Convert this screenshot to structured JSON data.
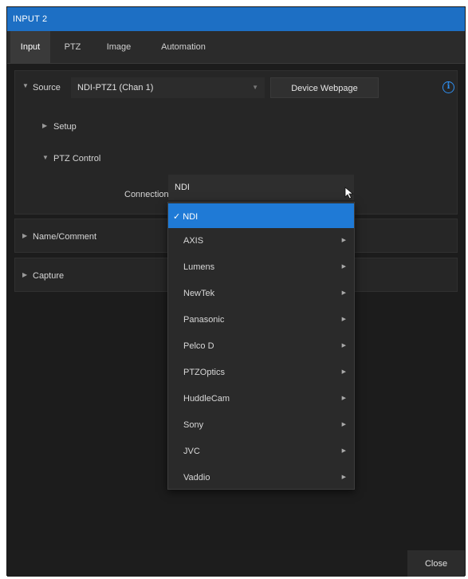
{
  "window": {
    "title": "INPUT 2"
  },
  "tabs": [
    {
      "label": "Input",
      "active": true
    },
    {
      "label": "PTZ",
      "active": false
    },
    {
      "label": "Image",
      "active": false
    },
    {
      "label": "Automation",
      "active": false
    }
  ],
  "source": {
    "label": "Source",
    "value": "NDI-PTZ1 (Chan 1)",
    "webpage_button": "Device Webpage",
    "setup_label": "Setup",
    "ptz_control_label": "PTZ Control"
  },
  "connection": {
    "label": "Connection",
    "value": "NDI",
    "options": [
      {
        "label": "NDI",
        "selected": true,
        "check": "✓"
      },
      {
        "label": "AXIS",
        "has_submenu": true
      },
      {
        "label": "Lumens",
        "has_submenu": true
      },
      {
        "label": "NewTek",
        "has_submenu": true
      },
      {
        "label": "Panasonic",
        "has_submenu": true
      },
      {
        "label": "Pelco D",
        "has_submenu": true
      },
      {
        "label": "PTZOptics",
        "has_submenu": true
      },
      {
        "label": "HuddleCam",
        "has_submenu": true
      },
      {
        "label": "Sony",
        "has_submenu": true
      },
      {
        "label": "JVC",
        "has_submenu": true
      },
      {
        "label": "Vaddio",
        "has_submenu": true
      }
    ]
  },
  "sections": {
    "name_comment": "Name/Comment",
    "capture": "Capture"
  },
  "footer": {
    "close_label": "Close"
  },
  "colors": {
    "titlebar": "#1d6fc4",
    "selected_item": "#1f7ad6",
    "info_icon": "#2f8ff0",
    "background": "#1c1c1c"
  }
}
